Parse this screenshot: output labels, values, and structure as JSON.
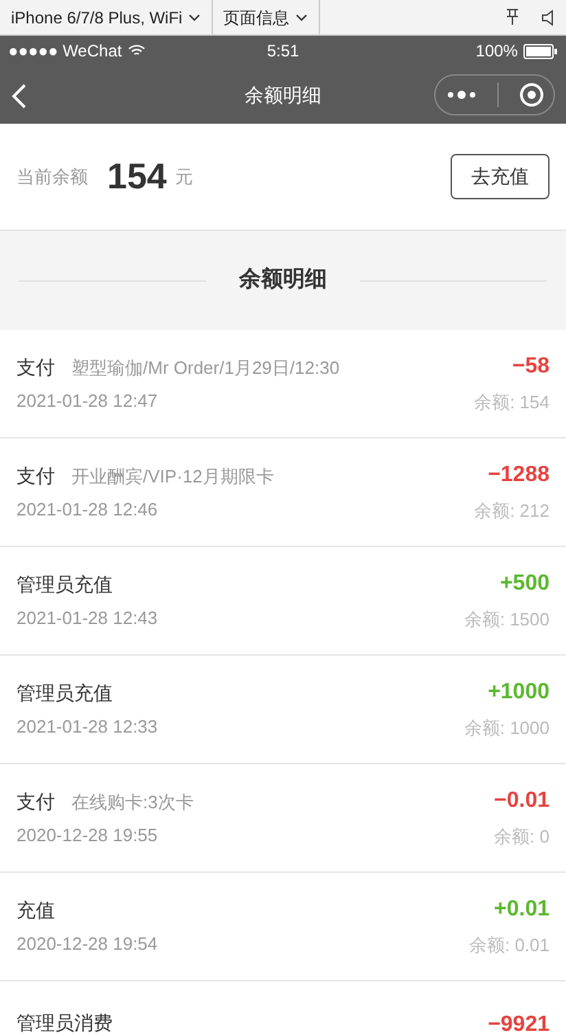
{
  "devtools": {
    "device": "iPhone 6/7/8 Plus, WiFi",
    "page_info": "页面信息"
  },
  "status_bar": {
    "carrier": "●●●●● WeChat",
    "time": "5:51",
    "battery": "100%"
  },
  "nav": {
    "title": "余额明细"
  },
  "balance": {
    "label": "当前余额",
    "amount": "154",
    "unit": "元",
    "button": "去充值"
  },
  "section": {
    "title": "余额明细"
  },
  "records": [
    {
      "title": "支付",
      "note": "塑型瑜伽/Mr Order/1月29日/12:30",
      "time": "2021-01-28 12:47",
      "amount": "−58",
      "color": "#e64340",
      "balance": "余额: 154"
    },
    {
      "title": "支付",
      "note": "开业酬宾/VIP·12月期限卡",
      "time": "2021-01-28 12:46",
      "amount": "−1288",
      "color": "#e64340",
      "balance": "余额: 212"
    },
    {
      "title": "管理员充值",
      "time": "2021-01-28 12:43",
      "amount": "+500",
      "color": "#5bb82f",
      "balance": "余额: 1500"
    },
    {
      "title": "管理员充值",
      "time": "2021-01-28 12:33",
      "amount": "+1000",
      "color": "#5bb82f",
      "balance": "余额: 1000"
    },
    {
      "title": "支付",
      "note": "在线购卡:3次卡",
      "time": "2020-12-28 19:55",
      "amount": "−0.01",
      "color": "#e64340",
      "balance": "余额: 0"
    },
    {
      "title": "充值",
      "time": "2020-12-28 19:54",
      "amount": "+0.01",
      "color": "#5bb82f",
      "balance": "余额: 0.01"
    },
    {
      "title": "管理员消费",
      "amount": "−9921",
      "color": "#e64340"
    }
  ]
}
